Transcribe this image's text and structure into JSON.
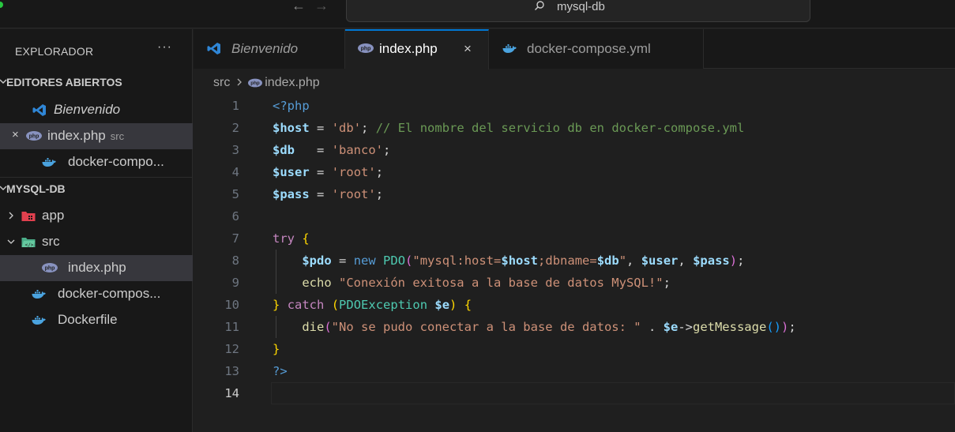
{
  "titlebar": {
    "back_arrow": "←",
    "forward_arrow": "→",
    "search_text": "mysql-db",
    "icons": {
      "search": "search-icon"
    }
  },
  "sidebar": {
    "title": "EXPLORADOR",
    "more": "···",
    "open_editors": {
      "label": "EDITORES ABIERTOS",
      "items": [
        {
          "label": "Bienvenido",
          "icon": "vscode-icon",
          "italic": true
        },
        {
          "label": "index.php",
          "desc": "src",
          "icon": "php-icon",
          "close": "×",
          "selected": true
        },
        {
          "label": "docker-compo...",
          "icon": "docker-icon"
        }
      ]
    },
    "workspace": {
      "label": "MYSQL-DB",
      "items": [
        {
          "label": "app",
          "icon": "folder-app-icon",
          "expanded": false
        },
        {
          "label": "src",
          "icon": "folder-src-icon",
          "expanded": true
        },
        {
          "label": "index.php",
          "icon": "php-icon",
          "selected": true
        },
        {
          "label": "docker-compos...",
          "icon": "docker-icon"
        },
        {
          "label": "Dockerfile",
          "icon": "docker-icon"
        }
      ]
    }
  },
  "tabs": [
    {
      "label": "Bienvenido",
      "icon": "vscode-icon",
      "italic": true,
      "active": false
    },
    {
      "label": "index.php",
      "icon": "php-icon",
      "close": "×",
      "active": true
    },
    {
      "label": "docker-compose.yml",
      "icon": "docker-icon",
      "active": false
    }
  ],
  "breadcrumb": {
    "folder": "src",
    "file": "index.php"
  },
  "editor": {
    "current_line": 14,
    "line_numbers": [
      "1",
      "2",
      "3",
      "4",
      "5",
      "6",
      "7",
      "8",
      "9",
      "10",
      "11",
      "12",
      "13",
      "14"
    ],
    "lines": [
      "<?php",
      "$host = 'db'; // El nombre del servicio db en docker-compose.yml",
      "$db   = 'banco';",
      "$user = 'root';",
      "$pass = 'root';",
      "",
      "try {",
      "    $pdo = new PDO(\"mysql:host=$host;dbname=$db\", $user, $pass);",
      "    echo \"Conexión exitosa a la base de datos MySQL!\";",
      "} catch (PDOException $e) {",
      "    die(\"No se pudo conectar a la base de datos: \" . $e->getMessage());",
      "}",
      "?>",
      ""
    ]
  },
  "colors": {
    "accent": "#0078d4",
    "php_icon": "#8892bf",
    "docker_icon": "#4aa3df",
    "vscode_icon": "#2f86d6"
  }
}
